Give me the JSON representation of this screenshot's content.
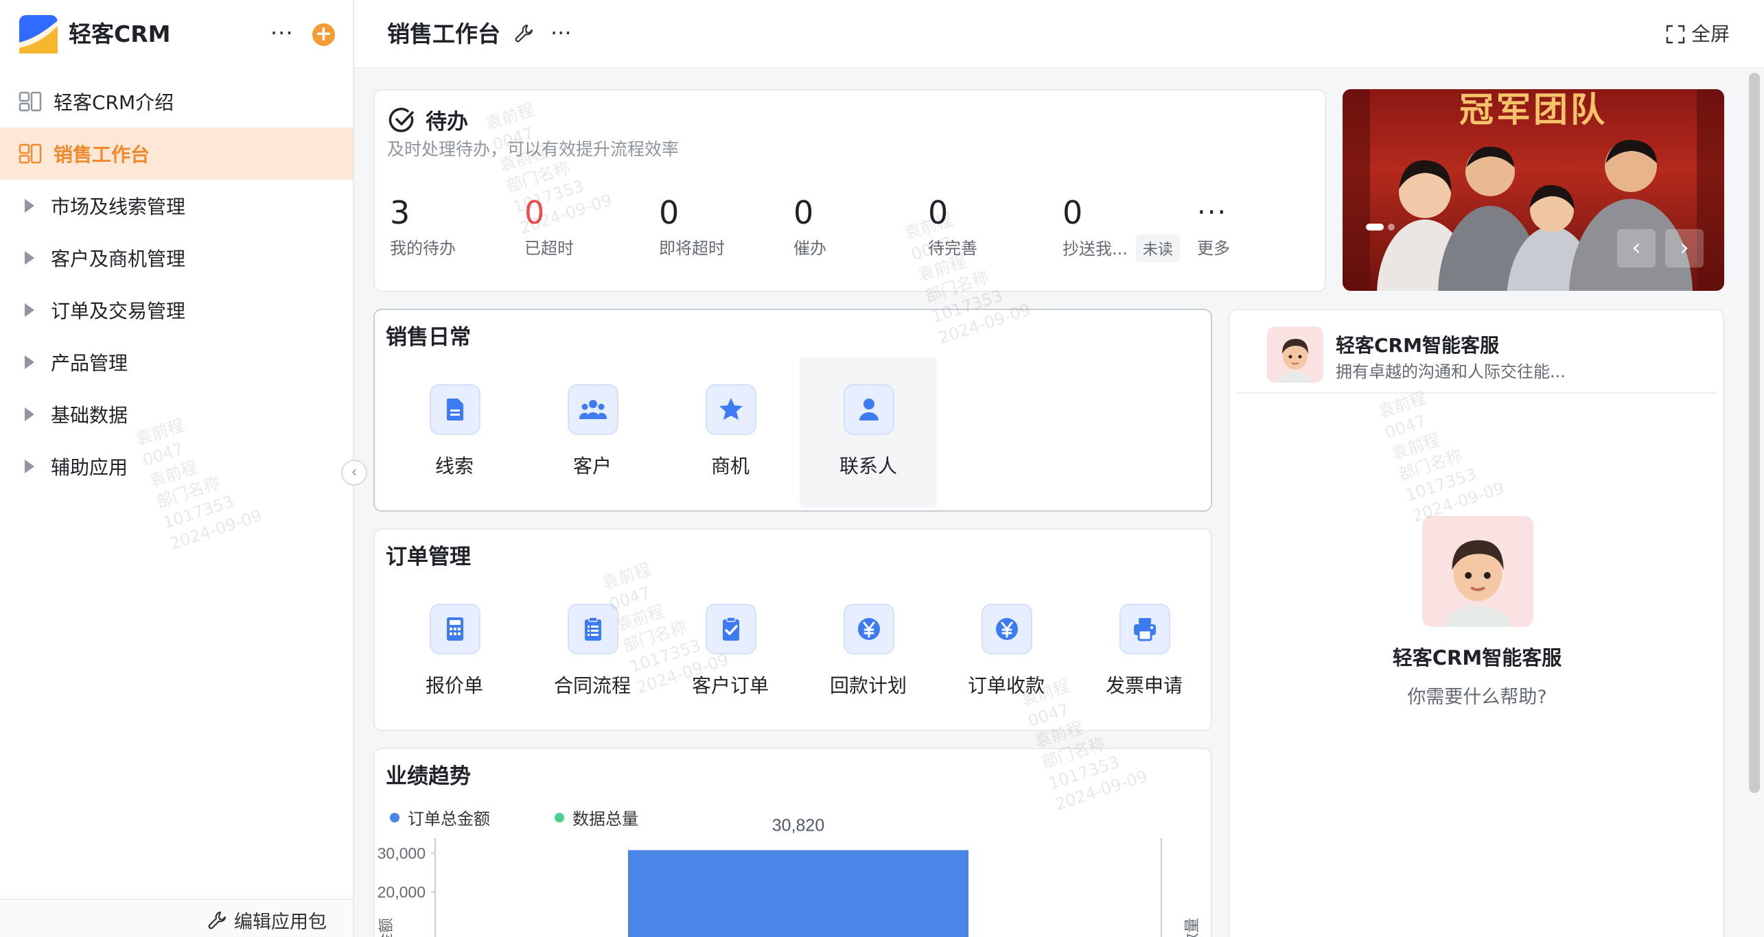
{
  "app": {
    "name": "轻客CRM",
    "more_icon": "ellipsis-icon",
    "add_icon": "plus-icon"
  },
  "sidebar": {
    "items": [
      {
        "label": "轻客CRM介绍",
        "kind": "page",
        "icon": "dashboard-icon"
      },
      {
        "label": "销售工作台",
        "kind": "page",
        "icon": "dashboard-icon",
        "active": true
      },
      {
        "label": "市场及线索管理",
        "kind": "group"
      },
      {
        "label": "客户及商机管理",
        "kind": "group"
      },
      {
        "label": "订单及交易管理",
        "kind": "group"
      },
      {
        "label": "产品管理",
        "kind": "group"
      },
      {
        "label": "基础数据",
        "kind": "group"
      },
      {
        "label": "辅助应用",
        "kind": "group"
      }
    ],
    "footer_edit": "编辑应用包"
  },
  "topbar": {
    "title": "销售工作台",
    "fullscreen": "全屏"
  },
  "todo": {
    "title": "待办",
    "subtitle": "及时处理待办，可以有效提升流程效率",
    "items": [
      {
        "value": "3",
        "label": "我的待办"
      },
      {
        "value": "0",
        "label": "已超时",
        "highlight": true
      },
      {
        "value": "0",
        "label": "即将超时"
      },
      {
        "value": "0",
        "label": "催办"
      },
      {
        "value": "0",
        "label": "待完善"
      },
      {
        "value": "0",
        "label": "抄送我...",
        "tag": "未读"
      }
    ],
    "more_label": "更多"
  },
  "banner": {
    "title": "冠军团队",
    "prev": "‹",
    "next": "›"
  },
  "daily": {
    "title": "销售日常",
    "entries": [
      {
        "label": "线索",
        "icon": "document-icon"
      },
      {
        "label": "客户",
        "icon": "people-icon"
      },
      {
        "label": "商机",
        "icon": "star-icon"
      },
      {
        "label": "联系人",
        "icon": "person-icon"
      }
    ]
  },
  "orders": {
    "title": "订单管理",
    "entries": [
      {
        "label": "报价单",
        "icon": "calculator-icon"
      },
      {
        "label": "合同流程",
        "icon": "clipboard-list-icon"
      },
      {
        "label": "客户订单",
        "icon": "clipboard-check-icon"
      },
      {
        "label": "回款计划",
        "icon": "yen-icon"
      },
      {
        "label": "订单收款",
        "icon": "yen-icon"
      },
      {
        "label": "发票申请",
        "icon": "printer-icon"
      }
    ]
  },
  "service": {
    "name": "轻客CRM智能客服",
    "desc": "拥有卓越的沟通和人际交往能...",
    "question": "你需要什么帮助?"
  },
  "performance": {
    "title": "业绩趋势"
  },
  "chart_data": {
    "type": "bar",
    "title": "业绩趋势",
    "series": [
      {
        "name": "订单总金额",
        "color": "#4a86e8",
        "values": [
          30820
        ]
      },
      {
        "name": "数据总量",
        "color": "#4ccf8f",
        "values": []
      }
    ],
    "categories": [
      ""
    ],
    "data_labels": [
      "30,820"
    ],
    "y_ticks": [
      "30,000",
      "20,000"
    ],
    "ylim": [
      0,
      35000
    ],
    "ylabel_left": "金额",
    "ylabel_right": "数量"
  },
  "watermark": {
    "lines": [
      "袁前程",
      "0047",
      "袁前程",
      "部门名称",
      "1017353",
      "2024-09-09"
    ]
  },
  "colors": {
    "accent": "#f08a2c",
    "active_bg": "#fde7d6",
    "primary": "#4a86e8",
    "danger": "#f04d4d"
  }
}
